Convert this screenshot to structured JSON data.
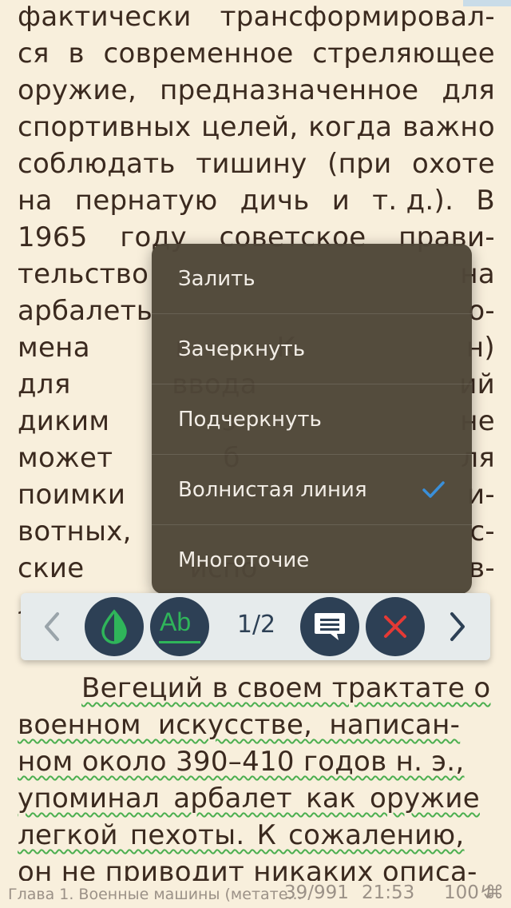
{
  "reader": {
    "upper_lines": [
      [
        "фактически",
        "трансформировал-"
      ],
      [
        "ся",
        "в",
        "современное",
        "стреляющее"
      ],
      [
        "оружие,",
        "предназначенное",
        "для"
      ],
      [
        "спортивных",
        "целей,",
        "когда",
        "важно"
      ],
      [
        "соблюдать",
        "тишину",
        "(при",
        "охоте"
      ],
      [
        "на",
        "пернатую",
        "дичь",
        "и",
        "т. д.).",
        "В"
      ],
      [
        "1965",
        "году",
        "советское",
        "прави-"
      ],
      [
        "тельство",
        "",
        "на"
      ],
      [
        "арбалеть",
        "",
        "о-"
      ],
      [
        "мена",
        "в",
        "К",
        "",
        "н)"
      ],
      [
        "для",
        "ввода",
        "",
        "ий"
      ],
      [
        "диким",
        "з",
        "",
        "не"
      ],
      [
        "может",
        "б",
        "",
        "ля"
      ],
      [
        "поимки",
        "",
        "и-"
      ],
      [
        "вотных,",
        "",
        "с-"
      ],
      [
        "ские",
        "испо",
        "",
        "в-"
      ],
      [
        "л",
        ""
      ]
    ],
    "lower_lines": [
      "Вегеций в своем трактате о",
      "военном искусстве, написан-",
      "ном около 390–410 годов н. э.,",
      "упоминал арбалет как оружие",
      "легкой пехоты. К сожалению,",
      "он не приводит никаких описа-"
    ]
  },
  "menu": {
    "items": [
      {
        "label": "Залить",
        "checked": false
      },
      {
        "label": "Зачеркнуть",
        "checked": false
      },
      {
        "label": "Подчеркнуть",
        "checked": false
      },
      {
        "label": "Волнистая линия",
        "checked": true
      },
      {
        "label": "Многоточие",
        "checked": false
      }
    ],
    "check_color": "#3a8fd9"
  },
  "toolbar": {
    "counter": "1/2",
    "ab_label": "Ab",
    "prev_icon": "chevron-left-icon",
    "next_icon": "chevron-right-icon",
    "color_icon": "droplet-icon",
    "note_icon": "comment-icon",
    "delete_icon": "close-icon",
    "accent_green": "#2fb55a",
    "delete_red": "#e53935",
    "button_bg": "#2d4055"
  },
  "status_bar": {
    "chapter": "Глава 1. Военные машины (метате...",
    "pages": "39/991",
    "time": "21:53",
    "battery": "100↯",
    "cmd": "⌘"
  }
}
